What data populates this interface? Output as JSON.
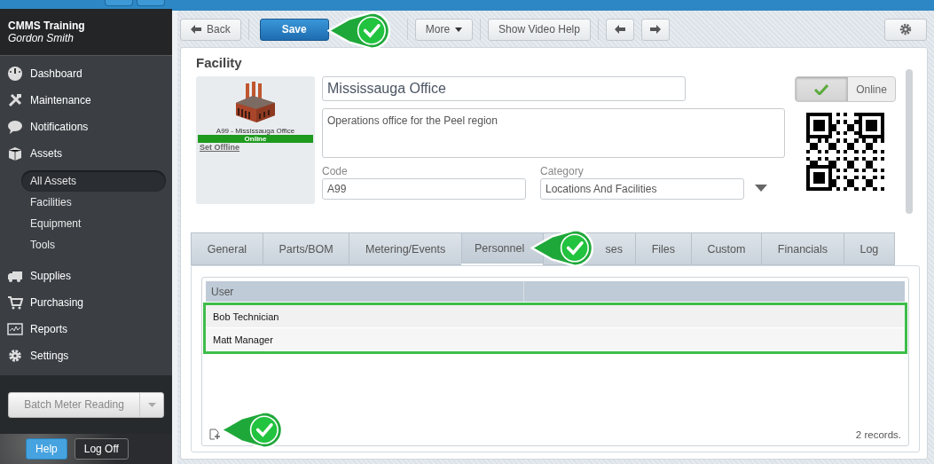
{
  "account": {
    "title": "CMMS Training",
    "user": "Gordon Smith"
  },
  "sidebar": {
    "items": [
      {
        "label": "Dashboard",
        "selected": false
      },
      {
        "label": "Maintenance",
        "selected": false
      },
      {
        "label": "Notifications",
        "selected": false
      },
      {
        "label": "Assets",
        "selected": false,
        "children": [
          {
            "label": "All Assets",
            "selected": true
          },
          {
            "label": "Facilities",
            "selected": false
          },
          {
            "label": "Equipment",
            "selected": false
          },
          {
            "label": "Tools",
            "selected": false
          }
        ]
      },
      {
        "label": "Supplies",
        "selected": false
      },
      {
        "label": "Purchasing",
        "selected": false
      },
      {
        "label": "Reports",
        "selected": false
      },
      {
        "label": "Settings",
        "selected": false
      }
    ],
    "batch_button": "Batch Meter Reading",
    "footer_buttons": [
      {
        "label": "Help",
        "kind": "primary"
      },
      {
        "label": "Log Off",
        "kind": "dark"
      }
    ]
  },
  "toolbar": [
    {
      "kind": "back",
      "label": "Back"
    },
    {
      "kind": "primary",
      "label": "Save",
      "callout": true
    },
    {
      "kind": "menu",
      "label": "More"
    },
    {
      "kind": "plain",
      "label": "Show Video Help"
    },
    {
      "kind": "prev"
    },
    {
      "kind": "next"
    },
    {
      "kind": "settings"
    }
  ],
  "record": {
    "heading": "Facility",
    "thumbnail_caption": "A99 - Mississauga Office",
    "status": "Online",
    "status_link": "Set Offline",
    "name": "Mississauga Office",
    "description": "Operations office for the Peel region",
    "code_label": "Code",
    "code": "A99",
    "category_label": "Category",
    "category": "Locations And Facilities",
    "toggle": {
      "on": true,
      "label": "Online"
    }
  },
  "tabs": [
    {
      "label": "General",
      "selected": false
    },
    {
      "label": "Parts/BOM",
      "selected": false
    },
    {
      "label": "Metering/Events",
      "selected": false
    },
    {
      "label": "Personnel",
      "selected": true,
      "callout": true
    },
    {
      "label": "ses",
      "selected": false
    },
    {
      "label": "Files",
      "selected": false
    },
    {
      "label": "Custom",
      "selected": false
    },
    {
      "label": "Financials",
      "selected": false
    },
    {
      "label": "Log",
      "selected": false
    }
  ],
  "table": {
    "callout": true,
    "columns": [
      "User"
    ],
    "rows": [
      [
        "Bob Technician"
      ],
      [
        "Matt Manager"
      ]
    ],
    "record_count": "2 records."
  }
}
